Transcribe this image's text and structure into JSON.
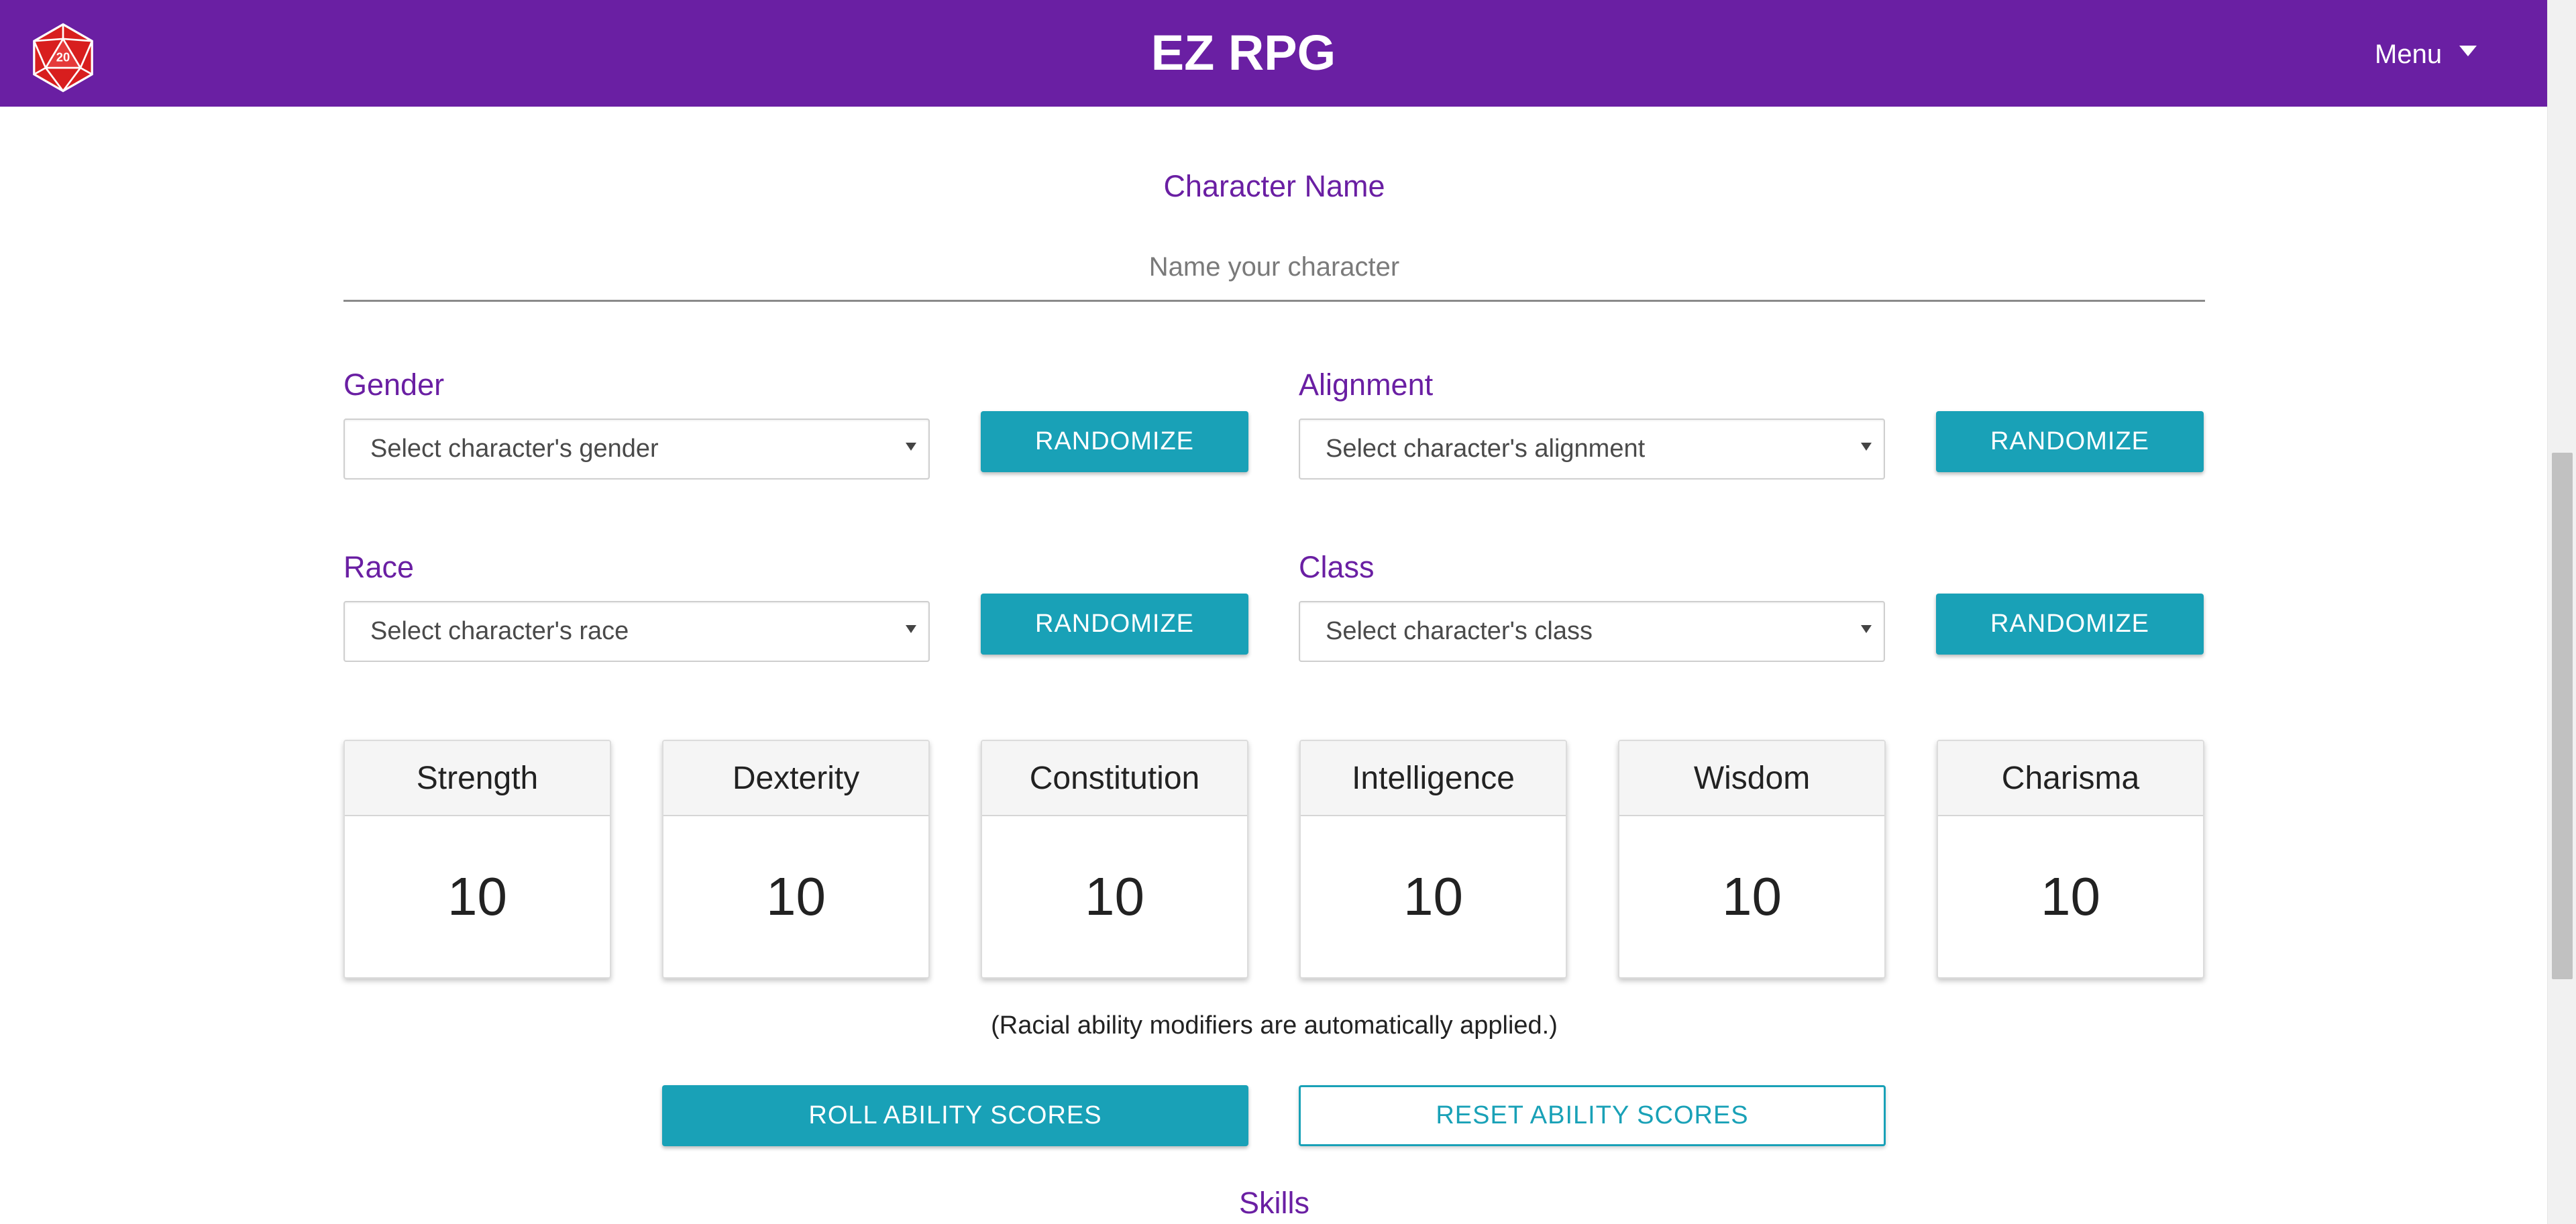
{
  "header": {
    "title": "EZ RPG",
    "menu_label": "Menu",
    "logo_die_face": "20",
    "brand_color": "#6a1fa3"
  },
  "name": {
    "label": "Character Name",
    "placeholder": "Name your character"
  },
  "fields": {
    "gender": {
      "label": "Gender",
      "placeholder": "Select character's gender"
    },
    "alignment": {
      "label": "Alignment",
      "placeholder": "Select character's alignment"
    },
    "race": {
      "label": "Race",
      "placeholder": "Select character's race"
    },
    "class": {
      "label": "Class",
      "placeholder": "Select character's class"
    },
    "randomize_label": "RANDOMIZE"
  },
  "abilities": [
    {
      "name": "Strength",
      "value": "10"
    },
    {
      "name": "Dexterity",
      "value": "10"
    },
    {
      "name": "Constitution",
      "value": "10"
    },
    {
      "name": "Intelligence",
      "value": "10"
    },
    {
      "name": "Wisdom",
      "value": "10"
    },
    {
      "name": "Charisma",
      "value": "10"
    }
  ],
  "note": "(Racial ability modifiers are automatically applied.)",
  "actions": {
    "roll_label": "ROLL ABILITY SCORES",
    "reset_label": "RESET ABILITY SCORES"
  },
  "skills_label": "Skills",
  "colors": {
    "accent": "#19a1b7",
    "label": "#6a1fa3"
  }
}
